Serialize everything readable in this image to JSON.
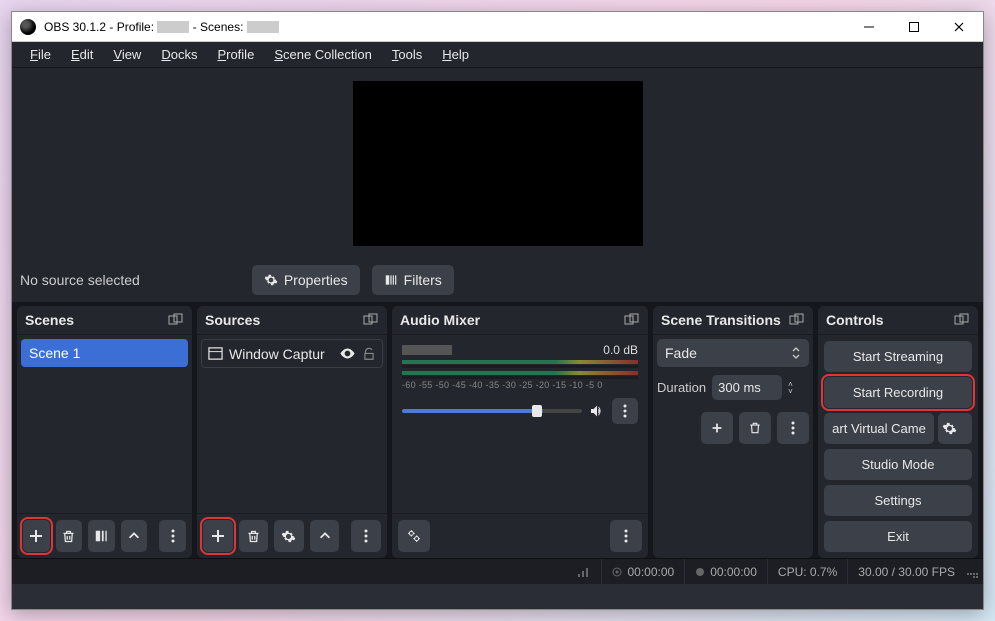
{
  "window": {
    "title_prefix": "OBS 30.1.2 - Profile: ",
    "title_mid": " - Scenes: "
  },
  "menu": {
    "file": "File",
    "edit": "Edit",
    "view": "View",
    "docks": "Docks",
    "profile": "Profile",
    "scene_collection": "Scene Collection",
    "tools": "Tools",
    "help": "Help"
  },
  "toolbar": {
    "no_source": "No source selected",
    "properties": "Properties",
    "filters": "Filters"
  },
  "scenes": {
    "title": "Scenes",
    "items": [
      "Scene 1"
    ]
  },
  "sources": {
    "title": "Sources",
    "items": [
      {
        "label": "Window Captur",
        "visible": true,
        "locked": false
      }
    ]
  },
  "audio": {
    "title": "Audio Mixer",
    "track": {
      "db": "0.0 dB",
      "ticks": "-60 -55 -50 -45 -40 -35 -30 -25 -20 -15 -10 -5 0"
    }
  },
  "transitions": {
    "title": "Scene Transitions",
    "current": "Fade",
    "duration_label": "Duration",
    "duration_value": "300 ms"
  },
  "controls": {
    "title": "Controls",
    "start_streaming": "Start Streaming",
    "start_recording": "Start Recording",
    "virtual_cam": "art Virtual Came",
    "studio_mode": "Studio Mode",
    "settings": "Settings",
    "exit": "Exit"
  },
  "status": {
    "live_time": "00:00:00",
    "rec_time": "00:00:00",
    "cpu": "CPU: 0.7%",
    "fps": "30.00 / 30.00 FPS"
  }
}
